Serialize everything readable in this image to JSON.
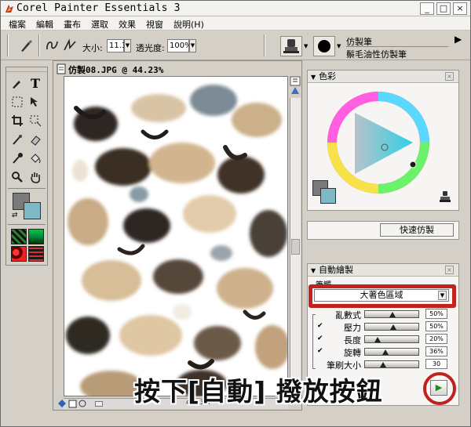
{
  "window": {
    "title": "Corel Painter Essentials 3",
    "minimize": "_",
    "maximize": "□",
    "close": "×"
  },
  "menu": [
    "檔案",
    "編輯",
    "畫布",
    "選取",
    "效果",
    "視窗",
    "說明(H)"
  ],
  "propbar": {
    "size_label": "大小:",
    "size_value": "11.3",
    "opacity_label": "透光度:",
    "opacity_value": "100%",
    "category": "仿製筆",
    "variant": "鬃毛油性仿製筆"
  },
  "document": {
    "title": "仿製08.JPG @ 44.23%",
    "zoom": "44.23%"
  },
  "color_panel": {
    "title": "色彩",
    "main_color": "#7a7a7a",
    "sub_color": "#7fb8c6"
  },
  "quick_clone": {
    "button": "快速仿製"
  },
  "auto_paint": {
    "title": "自動繪製",
    "strokes_label": "筆觸",
    "stroke_type": "大著色區域",
    "rows": [
      {
        "label": "亂數式",
        "value": "50%",
        "checked": false,
        "level": 0.5
      },
      {
        "label": "壓力",
        "value": "50%",
        "checked": true,
        "level": 0.52
      },
      {
        "label": "長度",
        "value": "20%",
        "checked": true,
        "level": 0.2
      },
      {
        "label": "旋轉",
        "value": "36%",
        "checked": true,
        "level": 0.36
      },
      {
        "label": "筆刷大小",
        "value": "30",
        "checked": false,
        "level": 0.3
      }
    ],
    "play_icon": "▶"
  },
  "caption": "按下[自動] 撥放按鈕",
  "colors": {
    "highlight": "#c0221d",
    "accent_cyan": "#2fd0e6"
  }
}
